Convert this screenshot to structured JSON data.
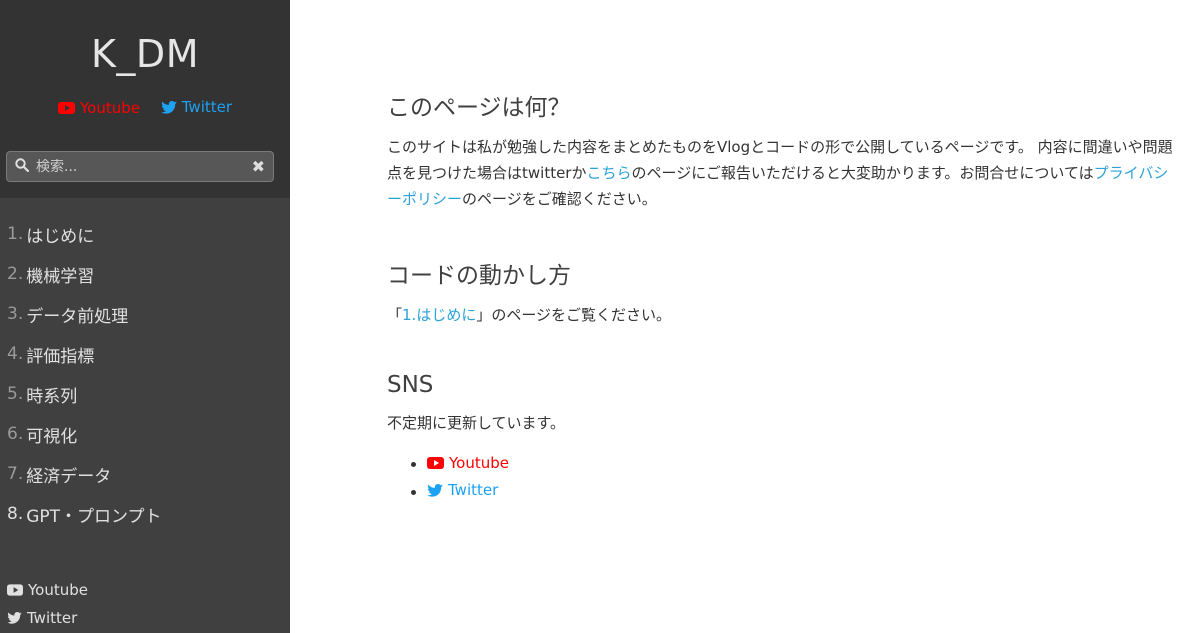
{
  "sidebar": {
    "title": "K_DM",
    "social_top": {
      "youtube": "Youtube",
      "twitter": "Twitter"
    },
    "search": {
      "placeholder": "検索...",
      "value": "",
      "clear": "✖"
    },
    "nav": [
      {
        "num": "1.",
        "label": "はじめに"
      },
      {
        "num": "2.",
        "label": "機械学習"
      },
      {
        "num": "3.",
        "label": "データ前処理"
      },
      {
        "num": "4.",
        "label": "評価指標"
      },
      {
        "num": "5.",
        "label": "時系列"
      },
      {
        "num": "6.",
        "label": "可視化"
      },
      {
        "num": "7.",
        "label": "経済データ"
      },
      {
        "num": "8.",
        "label": "GPT・プロンプト"
      }
    ],
    "social_bottom": {
      "youtube": "Youtube",
      "twitter": "Twitter"
    }
  },
  "main": {
    "section1": {
      "heading": "このページは何？",
      "text_a": "このサイトは私が勉強した内容をまとめたものをVlogとコードの形で公開しているページです。 内容に間違いや問題点を見つけた場合はtwitterか",
      "link_a": "こちら",
      "text_b": "のページにご報告いただけると大変助かります。お問合せについては",
      "link_b": "プライバシーポリシー",
      "text_c": "のページをご確認ください。"
    },
    "section2": {
      "heading": "コードの動かし方",
      "open": "「",
      "link": "1.はじめに",
      "rest": "」のページをご覧ください。"
    },
    "section3": {
      "heading": "SNS",
      "text": "不定期に更新しています。",
      "youtube": "Youtube",
      "twitter": "Twitter"
    }
  },
  "colors": {
    "sidebar_top": "#333333",
    "sidebar_bg": "#404040",
    "youtube_red": "#ff0000",
    "twitter_blue": "#1da1f2",
    "link_blue": "#2ba2d8"
  }
}
